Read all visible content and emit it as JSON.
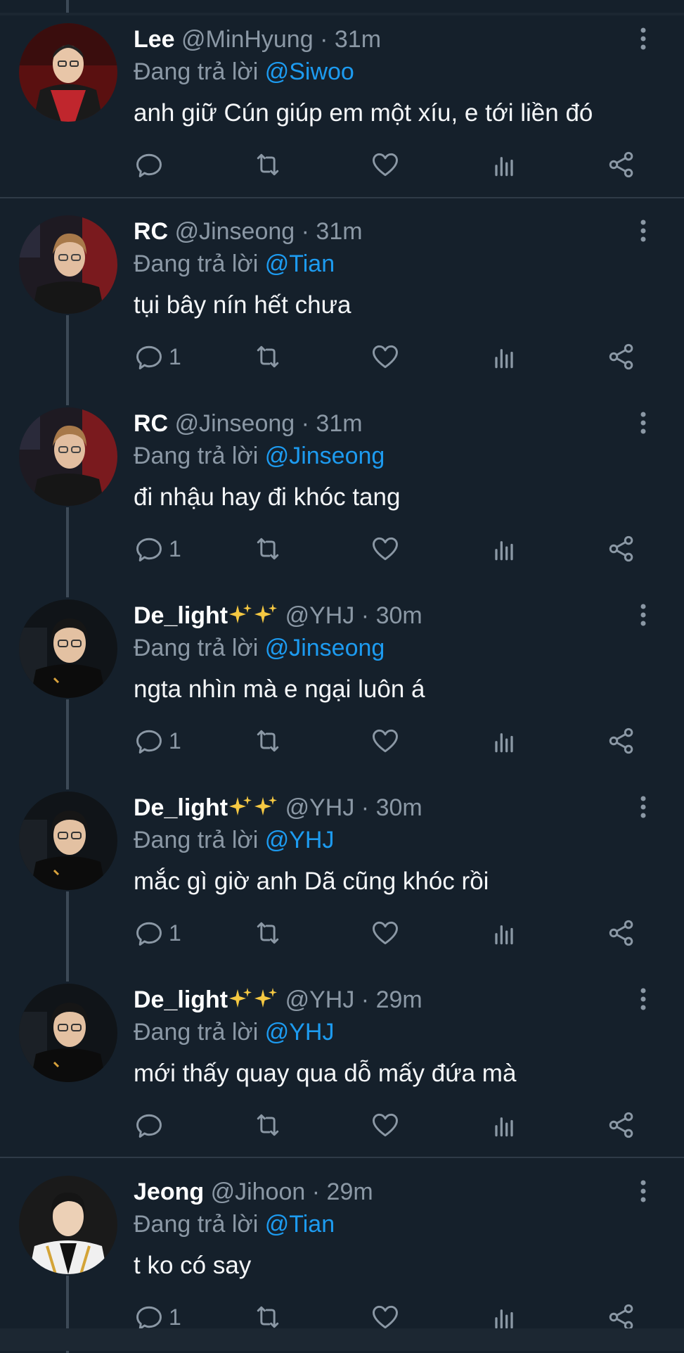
{
  "tweets": [
    {
      "name": "Lee",
      "handle": "@MinHyung",
      "dot": "·",
      "time": "31m",
      "replying_prefix": "Đang trả lời ",
      "reply_to": "@Siwoo",
      "text": "anh giữ Cún giúp em một xíu, e tới liền đó",
      "reply_count": "",
      "avatar": "avatar-red-jersey"
    },
    {
      "name": "RC",
      "handle": "@Jinseong",
      "dot": "·",
      "time": "31m",
      "replying_prefix": "Đang trả lời ",
      "reply_to": "@Tian",
      "text": "tụi bây nín hết chưa",
      "reply_count": "1",
      "avatar": "avatar-glasses-red-bg"
    },
    {
      "name": "RC",
      "handle": "@Jinseong",
      "dot": "·",
      "time": "31m",
      "replying_prefix": "Đang trả lời ",
      "reply_to": "@Jinseong",
      "text": "đi nhậu hay đi khóc tang",
      "reply_count": "1",
      "avatar": "avatar-glasses-red-bg"
    },
    {
      "name": "De_light",
      "handle": "@YHJ",
      "dot": "·",
      "time": "30m",
      "replying_prefix": "Đang trả lời ",
      "reply_to": "@Jinseong",
      "text": "ngta nhìn mà e ngại luôn á",
      "reply_count": "1",
      "avatar": "avatar-glasses-dark-bg"
    },
    {
      "name": "De_light",
      "handle": "@YHJ",
      "dot": "·",
      "time": "30m",
      "replying_prefix": "Đang trả lời ",
      "reply_to": "@YHJ",
      "text": "mắc gì giờ anh Dã cũng khóc rồi",
      "reply_count": "1",
      "avatar": "avatar-glasses-dark-bg"
    },
    {
      "name": "De_light",
      "handle": "@YHJ",
      "dot": "·",
      "time": "29m",
      "replying_prefix": "Đang trả lời ",
      "reply_to": "@YHJ",
      "text": "mới thấy quay qua dỗ mấy đứa mà",
      "reply_count": "",
      "avatar": "avatar-glasses-dark-bg"
    },
    {
      "name": "Jeong",
      "handle": "@Jihoon",
      "dot": "·",
      "time": "29m",
      "replying_prefix": "Đang trả lời ",
      "reply_to": "@Tian",
      "text": "t ko có say",
      "reply_count": "1",
      "avatar": "avatar-white-jersey"
    }
  ],
  "colors": {
    "background": "#15202b",
    "mention": "#1d9bf0",
    "muted": "#8b98a5",
    "thread_line": "#3d4a57"
  }
}
